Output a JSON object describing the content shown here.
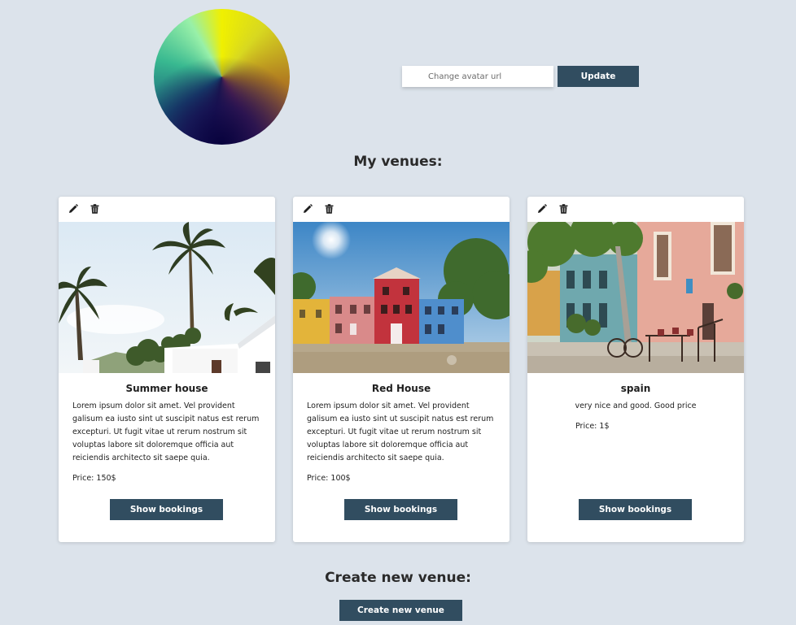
{
  "avatar": {
    "placeholder": "Change avatar url",
    "update_label": "Update"
  },
  "my_venues_title": "My venues:",
  "venues": [
    {
      "title": "Summer house",
      "description": "Lorem ipsum dolor sit amet. Vel provident galisum ea iusto sint ut suscipit natus est rerum excepturi. Ut fugit vitae ut rerum nostrum sit voluptas labore sit doloremque officia aut reiciendis architecto sit saepe quia.",
      "price": "Price: 150$",
      "button": "Show bookings",
      "icons": {
        "edit": "pencil-icon",
        "delete": "trash-icon"
      }
    },
    {
      "title": "Red House",
      "description": "Lorem ipsum dolor sit amet. Vel provident galisum ea iusto sint ut suscipit natus est rerum excepturi. Ut fugit vitae ut rerum nostrum sit voluptas labore sit doloremque officia aut reiciendis architecto sit saepe quia.",
      "price": "Price: 100$",
      "button": "Show bookings",
      "icons": {
        "edit": "pencil-icon",
        "delete": "trash-icon"
      }
    },
    {
      "title": "spain",
      "description": "very nice and good. Good price",
      "price": "Price: 1$",
      "button": "Show bookings",
      "icons": {
        "edit": "pencil-icon",
        "delete": "trash-icon"
      }
    }
  ],
  "create_title": "Create new venue:",
  "create_button": "Create new venue",
  "colors": {
    "background": "#dce3eb",
    "button": "#314d60",
    "card": "#ffffff"
  }
}
